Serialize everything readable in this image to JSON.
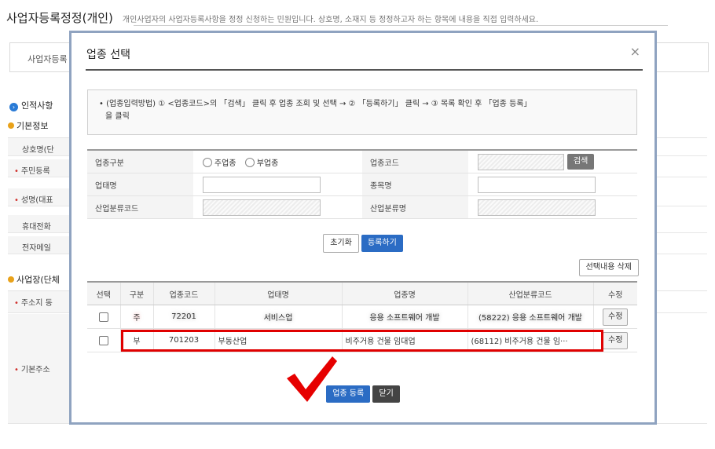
{
  "background": {
    "title": "사업자등록정정(개인)",
    "subtitle": "개인사업자의 사업자등록사항을 정정 신청하는 민원입니다. 상호명, 소재지 등 정정하고자 하는 항목에 내용을 직접 입력하세요.",
    "tab_label": "사업자등록",
    "section_personal": "인적사항",
    "section_basic": "기본정보",
    "rows": [
      "상호명(단",
      "주민등록",
      "성명(대표",
      "휴대전화",
      "전자메일"
    ],
    "section_business": "사업장(단체",
    "address_label": "주소지 동",
    "base_address_label": "기본주소"
  },
  "modal": {
    "title": "업종 선택",
    "close_icon": "×",
    "notice_lines": [
      "• (업종입력방법) ① <업종코드>의 「검색」 클릭 후 업종 조회 및 선택 → ② 「등록하기」 클릭 → ③ 목록 확인 후 「업종 등록」",
      "을 클릭"
    ],
    "form": {
      "category_label": "업종구분",
      "radio_main": "주업종",
      "radio_sub": "부업종",
      "code_label": "업종코드",
      "search_button": "검색",
      "type_label": "업태명",
      "item_label": "종목명",
      "industry_code_label": "산업분류코드",
      "industry_name_label": "산업분류명"
    },
    "reset_button": "초기화",
    "register_button": "등록하기",
    "delete_selected_button": "선택내용 삭제",
    "list": {
      "headers": [
        "선택",
        "구분",
        "업종코드",
        "업태명",
        "업종명",
        "산업분류코드",
        "수정"
      ],
      "rows": [
        {
          "type": "주",
          "code": "72201",
          "biz_type": "서비스업",
          "item": "응용 소프트웨어 개발",
          "industry": "(58222) 응용 소프트웨어 개발",
          "edit": "수정",
          "blurred": true
        },
        {
          "type": "부",
          "code": "701203",
          "biz_type": "부동산업",
          "item": "비주거용 건물 임대업",
          "industry": "(68112) 비주거용 건물 임···",
          "edit": "수정",
          "blurred": false
        }
      ]
    },
    "submit_button": "업종 등록",
    "close_button": "닫기"
  },
  "colors": {
    "modal_border": "#8fa3c0",
    "primary_blue": "#2b6cc4",
    "highlight_red": "#e00000",
    "checkmark_red": "#e60000"
  },
  "icons": {
    "close": "close-icon",
    "checkmark": "checkmark-icon"
  }
}
